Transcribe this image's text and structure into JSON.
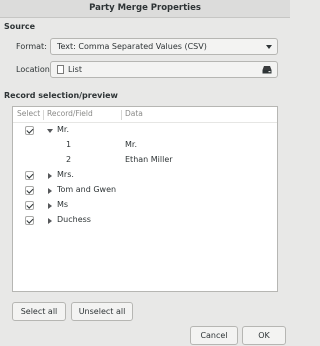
{
  "dialog": {
    "title": "Party Merge Properties"
  },
  "source": {
    "heading": "Source",
    "format_label": "Format:",
    "format_value": "Text: Comma Separated Values (CSV)",
    "location_label": "Location:",
    "location_value": "List"
  },
  "records": {
    "heading": "Record selection/preview",
    "columns": {
      "select": "Select",
      "record_field": "Record/Field",
      "data": "Data"
    },
    "rows": [
      {
        "label": "Mr.",
        "checked": true,
        "expanded": true
      },
      {
        "field": "1",
        "data": "Mr."
      },
      {
        "field": "2",
        "data": "Ethan Miller"
      },
      {
        "label": "Mrs.",
        "checked": true,
        "expanded": false
      },
      {
        "label": "Tom and Gwen",
        "checked": true,
        "expanded": false
      },
      {
        "label": "Ms",
        "checked": true,
        "expanded": false
      },
      {
        "label": "Duchess",
        "checked": true,
        "expanded": false
      }
    ]
  },
  "buttons": {
    "select_all": "Select all",
    "unselect_all": "Unselect all",
    "cancel": "Cancel",
    "ok": "OK"
  }
}
